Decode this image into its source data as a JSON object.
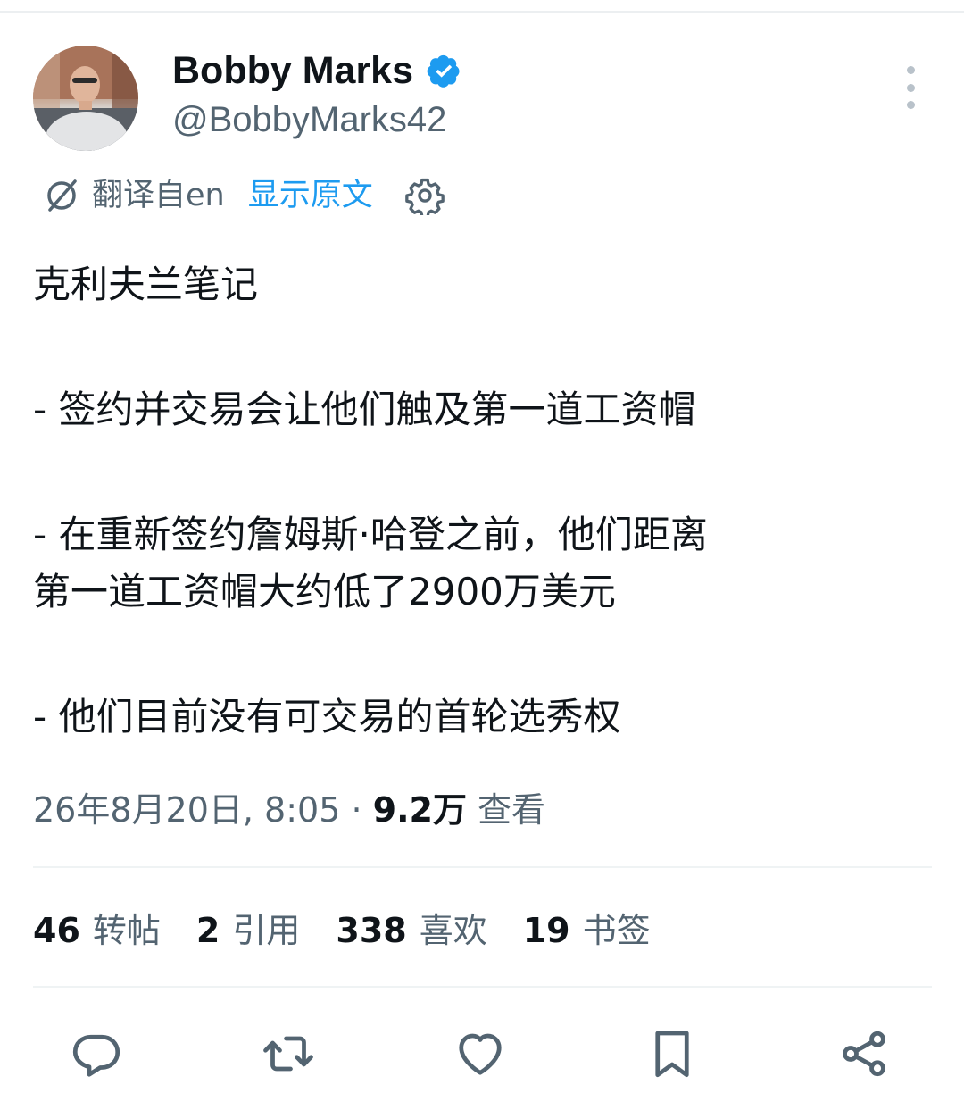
{
  "user": {
    "display_name": "Bobby Marks",
    "handle": "@BobbyMarks42",
    "verified_color": "#1d9bf0"
  },
  "translation": {
    "translated_from": "翻译自en",
    "show_original": "显示原文"
  },
  "tweet": {
    "lines": [
      "克利夫兰笔记",
      "- 签约并交易会让他们触及第一道工资帽",
      "- 在重新签约詹姆斯·哈登之前，他们距离",
      "第一道工资帽大约低了2900万美元",
      "- 他们目前没有可交易的首轮选秀权"
    ]
  },
  "meta": {
    "timestamp": "26年8月20日, 8:05 · ",
    "views_count": "9.2万",
    "views_label": " 查看"
  },
  "stats": [
    {
      "count": "46",
      "label": "转帖"
    },
    {
      "count": "2",
      "label": "引用"
    },
    {
      "count": "338",
      "label": "喜欢"
    },
    {
      "count": "19",
      "label": "书签"
    }
  ],
  "actions": [
    "reply-icon",
    "repost-icon",
    "like-icon",
    "bookmark-icon",
    "share-icon"
  ],
  "colors": {
    "text": "#0f1419",
    "secondary": "#536471",
    "accent": "#1d9bf0"
  }
}
